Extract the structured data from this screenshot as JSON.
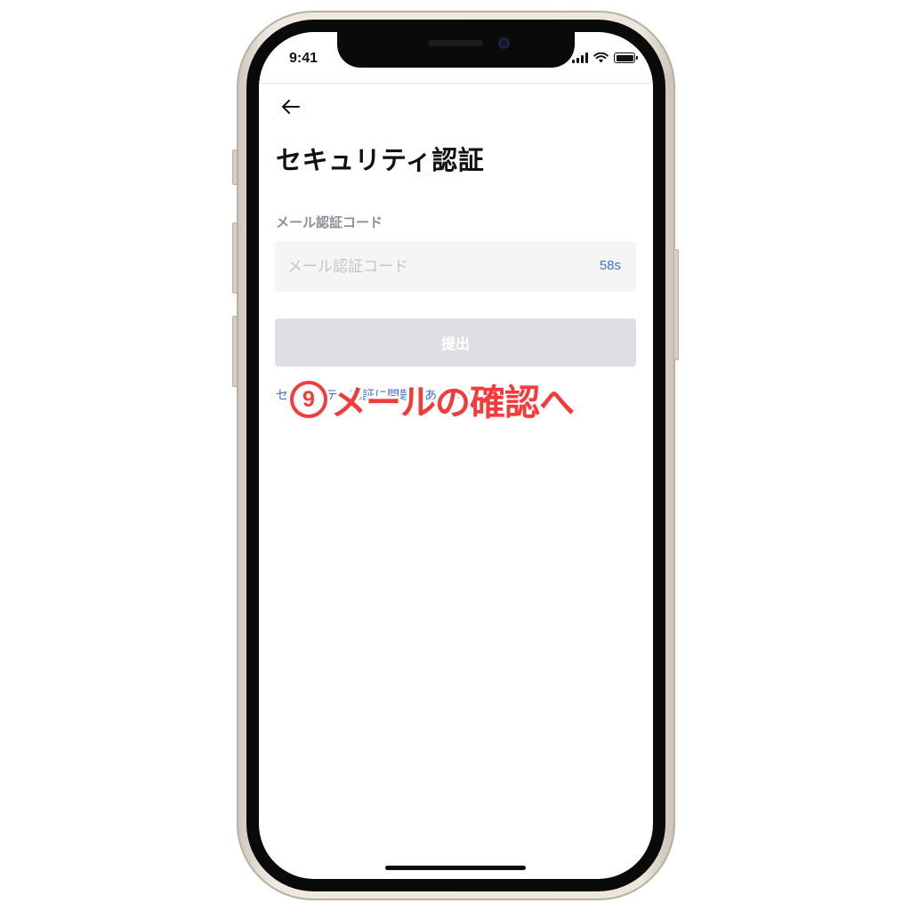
{
  "status_bar": {
    "time": "9:41",
    "icons": [
      "cellular-signal-icon",
      "wifi-icon",
      "battery-icon"
    ]
  },
  "header": {
    "back_icon": "arrow-left-icon",
    "title": "セキュリティ認証"
  },
  "email_code": {
    "label": "メール認証コード",
    "placeholder": "メール認証コード",
    "value": "",
    "countdown": "58s"
  },
  "submit": {
    "label": "提出"
  },
  "security_link": {
    "label": "セキュリティ認証に問題がありますか？"
  },
  "annotation": {
    "number": "9",
    "text": "メールの確認へ",
    "color": "#f23b3b"
  },
  "colors": {
    "accent_blue": "#3e72c4",
    "button_disabled": "#dedfe2",
    "input_bg": "#f5f5f6",
    "label_gray": "#8b8f96"
  }
}
